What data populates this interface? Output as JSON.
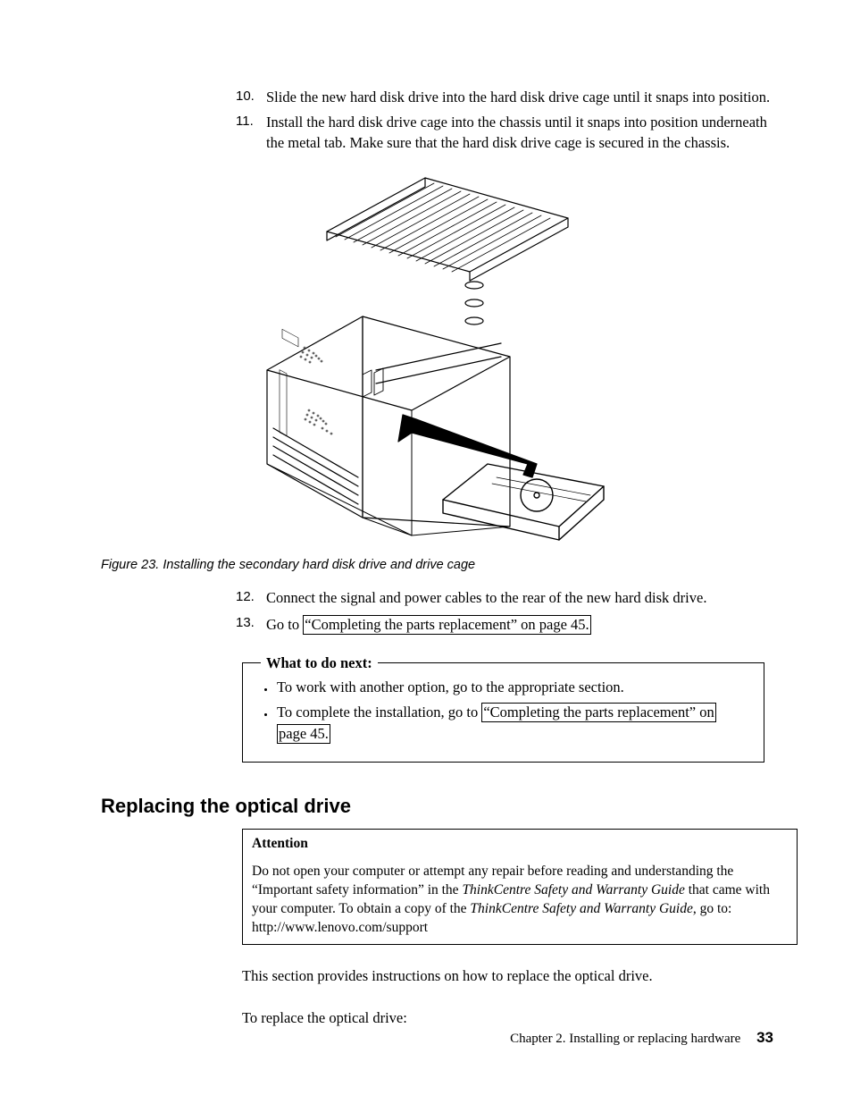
{
  "steps_top": [
    {
      "num": "10.",
      "text": "Slide the new hard disk drive into the hard disk drive cage until it snaps into position."
    },
    {
      "num": "11.",
      "text": "Install the hard disk drive cage into the chassis until it snaps into position underneath the metal tab. Make sure that the hard disk drive cage is secured in the chassis."
    }
  ],
  "figure": {
    "caption": "Figure 23. Installing the secondary hard disk drive and drive cage"
  },
  "steps_bottom": [
    {
      "num": "12.",
      "text": "Connect the signal and power cables to the rear of the new hard disk drive."
    },
    {
      "num": "13.",
      "pre": "Go to ",
      "xref": "“Completing the parts replacement” on page 45."
    }
  ],
  "wtdn": {
    "legend": "What to do next:",
    "items": [
      {
        "text": "To work with another option, go to the appropriate section."
      },
      {
        "pre": "To complete the installation, go to ",
        "xref1": "“Completing the parts replacement” on",
        "xref2": "page 45."
      }
    ]
  },
  "heading": "Replacing the optical drive",
  "attention": {
    "title": "Attention",
    "p1a": "Do not open your computer or attempt any repair before reading and understanding the “Important safety information” in the ",
    "p1i": "ThinkCentre Safety and Warranty Guide",
    "p1b": " that came with your computer. To obtain a copy of the ",
    "p1i2": "ThinkCentre Safety and Warranty Guide",
    "p1c": ", go to:",
    "url": "http://www.lenovo.com/support"
  },
  "paras": [
    "This section provides instructions on how to replace the optical drive.",
    "To replace the optical drive:"
  ],
  "footer": {
    "chapter": "Chapter 2. Installing or replacing hardware",
    "page": "33"
  }
}
